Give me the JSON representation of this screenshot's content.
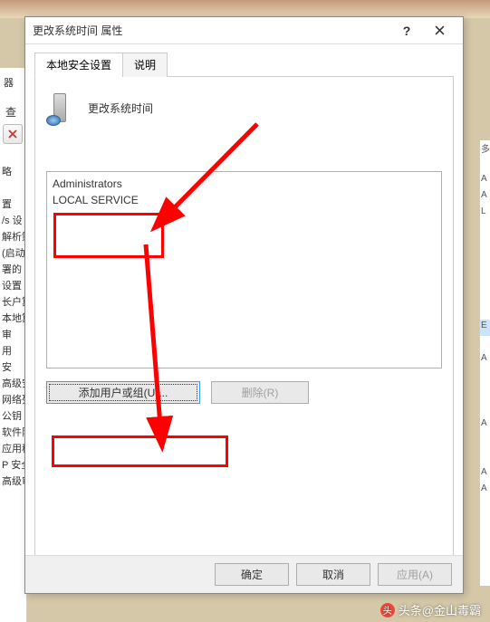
{
  "dialog": {
    "title": "更改系统时间 属性",
    "help": "?",
    "tabs": {
      "tab1": "本地安全设置",
      "tab2": "说明"
    },
    "headerTitle": "更改系统时间",
    "listEntries": {
      "e0": "Administrators",
      "e1": "LOCAL SERVICE"
    },
    "buttons": {
      "add": "添加用户或组(U)...",
      "remove": "删除(R)",
      "ok": "确定",
      "cancel": "取消",
      "apply": "应用(A)"
    }
  },
  "leftPanel": {
    "top": "器",
    "q": "查",
    "items": {
      "i0": "略",
      "i1": "",
      "i2": "置",
      "i3": "/s 设",
      "i4": "解析策",
      "i5": "(启动",
      "i6": "署的",
      "i7": "设置",
      "i8": "长户算",
      "i9": "本地算",
      "i10": "审",
      "i11": "用",
      "i12": "安",
      "i13": "高级安",
      "i14": "网络列",
      "i15": "公钥",
      "i16": "软件限",
      "i17": "应用程",
      "i18": "P 安全",
      "i19": "高级审"
    }
  },
  "rightPanel": {
    "r0": "多",
    "r1": "",
    "r2": "A",
    "r3": "A",
    "r4": "L",
    "r5": "",
    "r6": "",
    "r7": "",
    "r8": "",
    "r9": "",
    "r10": "",
    "r11": "E",
    "r12": "",
    "r13": "A",
    "r14": "",
    "r15": "",
    "r16": "",
    "r17": "A",
    "r18": "",
    "r19": "",
    "r20": "A",
    "r21": "A"
  },
  "watermark": "头条@金山毒霸"
}
